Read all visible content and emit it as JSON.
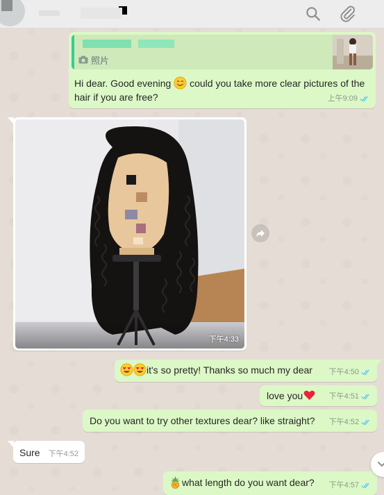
{
  "header": {
    "contact_name": "",
    "icons": [
      "search-icon",
      "attach-icon"
    ]
  },
  "messages": [
    {
      "direction": "out",
      "quote_label": "照片",
      "quote_icon": "camera-icon",
      "text": "Hi dear. Good evening",
      "emoji": "smiling-face-emoji",
      "text_after_emoji": "could you take more clear pictures of the hair if you are free?",
      "time": "上午9:09",
      "status": "read"
    },
    {
      "direction": "in",
      "type": "image",
      "time": "下午4:33"
    },
    {
      "direction": "out",
      "emojis": [
        "heart-eyes-emoji",
        "heart-eyes-emoji"
      ],
      "text": "it's so pretty! Thanks so much my dear",
      "time": "下午4:50",
      "status": "read"
    },
    {
      "direction": "out",
      "text": "love you",
      "emoji": "red-heart-emoji",
      "time": "下午4:51",
      "status": "read"
    },
    {
      "direction": "out",
      "text": "Do you want to try other textures dear? like straight?",
      "time": "下午4:52",
      "status": "read"
    },
    {
      "direction": "in",
      "text": "Sure",
      "time": "下午4:52"
    },
    {
      "direction": "out",
      "emoji": "pineapple-emoji",
      "text": "what length do you want dear?",
      "time": "下午4:57",
      "status": "read"
    }
  ],
  "colors": {
    "outgoing_bubble": "#dcf8c6",
    "incoming_bubble": "#ffffff",
    "chat_background": "#e5ddd5",
    "read_ticks": "#4fc3f7",
    "quote_bar": "#35cd96"
  }
}
